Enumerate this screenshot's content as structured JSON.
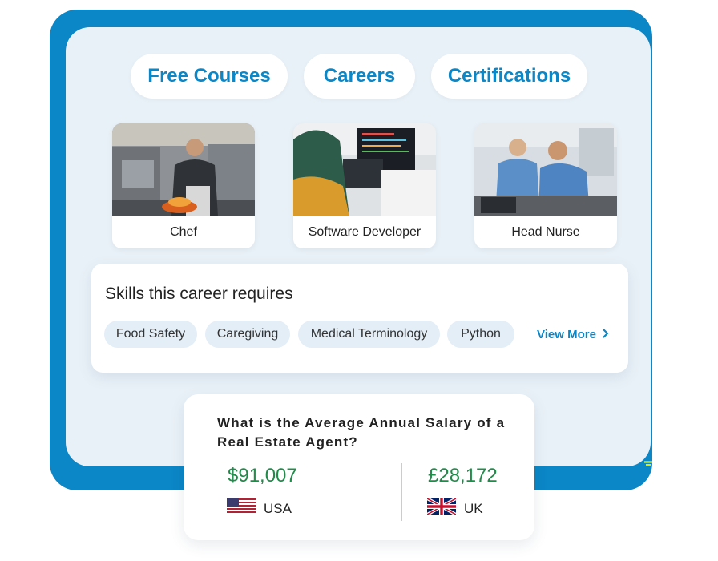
{
  "nav": {
    "free_courses": "Free Courses",
    "careers": "Careers",
    "certifications": "Certifications"
  },
  "careers": [
    {
      "label": "Chef"
    },
    {
      "label": "Software Developer"
    },
    {
      "label": "Head Nurse"
    }
  ],
  "skills": {
    "title": "Skills this career requires",
    "chips": [
      "Food Safety",
      "Caregiving",
      "Medical Terminology",
      "Python"
    ],
    "view_more": "View More"
  },
  "salary": {
    "question": "What is the Average Annual Salary of a Real Estate Agent?",
    "entries": [
      {
        "amount": "$91,007",
        "country": "USA",
        "flag": "us-flag-icon"
      },
      {
        "amount": "£28,172",
        "country": "UK",
        "flag": "uk-flag-icon"
      }
    ]
  },
  "colors": {
    "accent": "#0b86c6",
    "panel": "#e9f1f8",
    "salary_green": "#1f8c4a",
    "chip_bg": "#e3eef7"
  }
}
